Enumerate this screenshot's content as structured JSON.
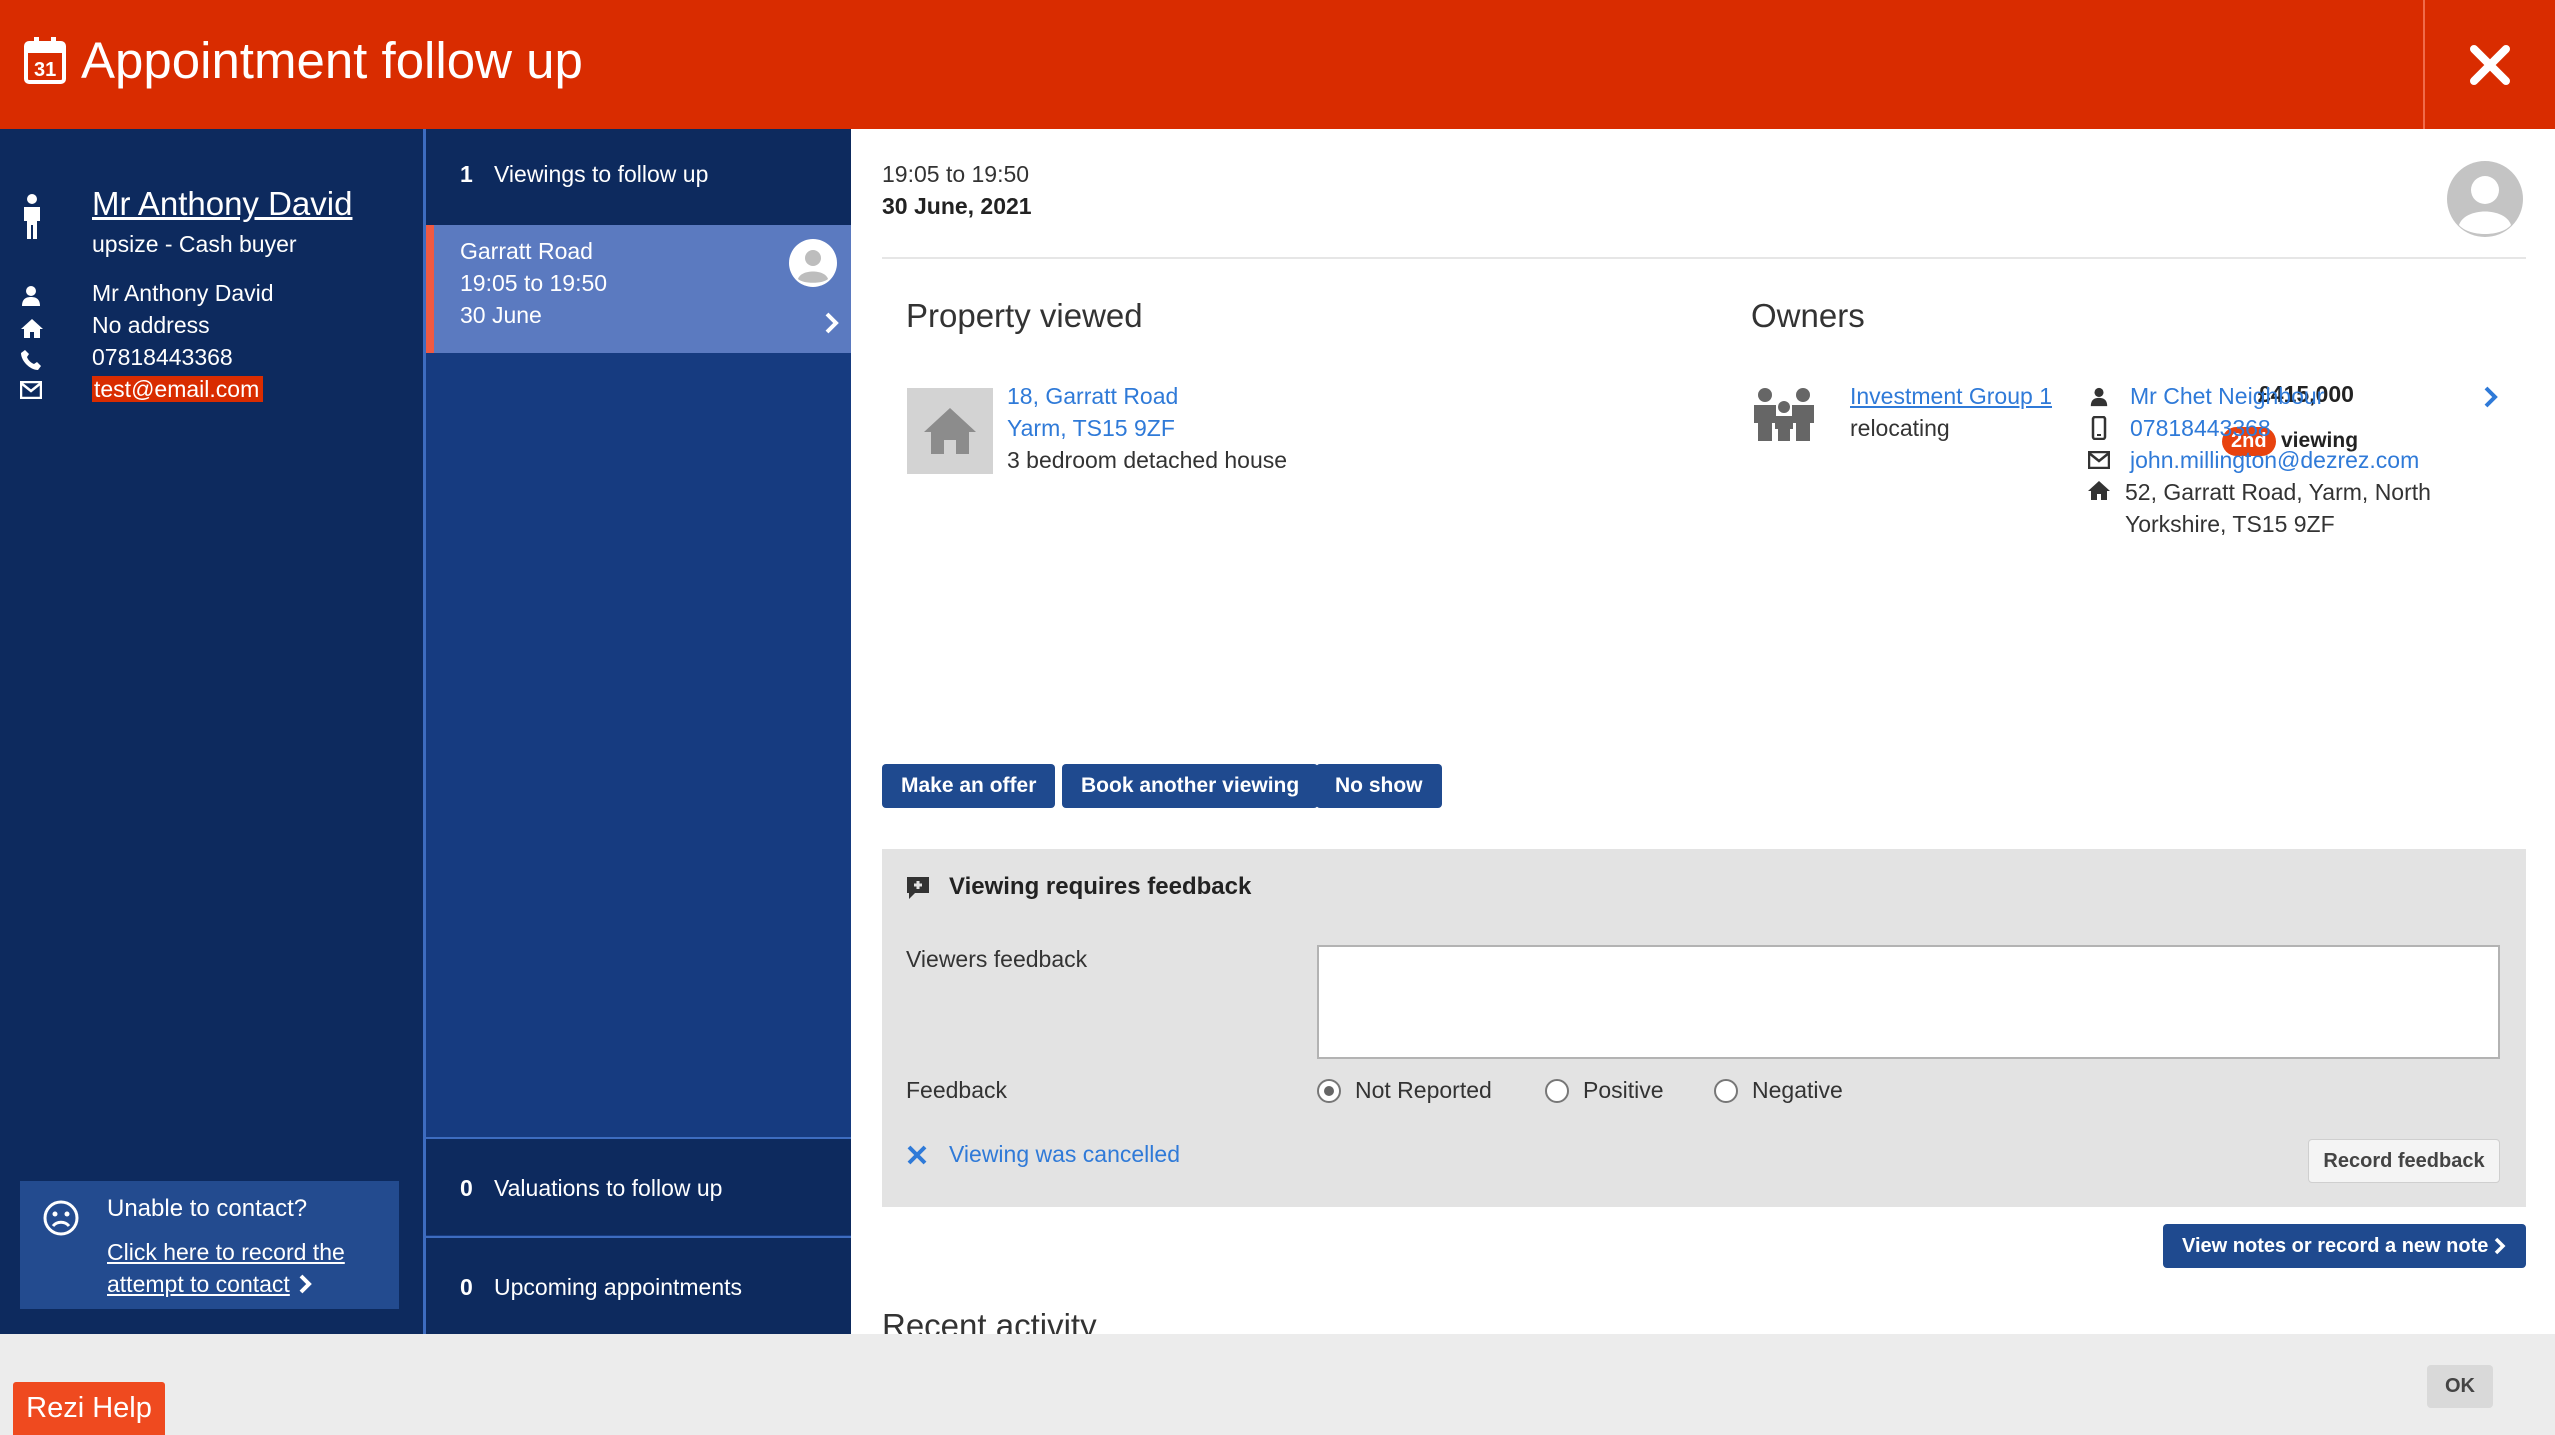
{
  "header": {
    "title": "Appointment follow up",
    "icon": "calendar-icon",
    "close_icon": "close-icon",
    "color": "#d92c00"
  },
  "contact": {
    "name": "Mr Anthony David",
    "subtitle": "upsize - Cash buyer",
    "person": "Mr Anthony David",
    "address": "No address",
    "phone": "07818443368",
    "email": "test@email.com",
    "unable": {
      "title": "Unable to contact?",
      "link_line1": "Click here to record the",
      "link_line2": "attempt to contact"
    }
  },
  "queue": {
    "viewings": {
      "count": "1",
      "label": "Viewings to follow up"
    },
    "item": {
      "street": "Garratt Road",
      "time": "19:05 to 19:50",
      "date": "30 June"
    },
    "valuations": {
      "count": "0",
      "label": "Valuations to follow up"
    },
    "upcoming": {
      "count": "0",
      "label": "Upcoming appointments"
    }
  },
  "appointment": {
    "time": "19:05 to 19:50",
    "date": "30 June, 2021"
  },
  "property": {
    "heading": "Property viewed",
    "line1": "18, Garratt Road",
    "line2": "Yarm, TS15 9ZF",
    "description": "3 bedroom detached house",
    "price": "£415,000",
    "viewing_ordinal": "2nd",
    "viewing_label": "viewing"
  },
  "owners": {
    "heading": "Owners",
    "group": "Investment Group 1",
    "status": "relocating",
    "name": "Mr Chet Neighbour",
    "phone": "07818443368",
    "email": "john.millington@dezrez.com",
    "address_line1": "52, Garratt Road, Yarm, North",
    "address_line2": "Yorkshire, TS15 9ZF"
  },
  "actions": {
    "offer": "Make an offer",
    "book": "Book another viewing",
    "noshow": "No show"
  },
  "feedback": {
    "title": "Viewing requires feedback",
    "viewers_label": "Viewers feedback",
    "viewers_value": "",
    "feedback_label": "Feedback",
    "options": [
      "Not Reported",
      "Positive",
      "Negative"
    ],
    "selected": "Not Reported",
    "cancelled": "Viewing was cancelled",
    "record": "Record feedback"
  },
  "notes_button": "View notes or record a new note",
  "recent_heading": "Recent activity",
  "footer": {
    "help": "Rezi Help",
    "ok": "OK"
  }
}
